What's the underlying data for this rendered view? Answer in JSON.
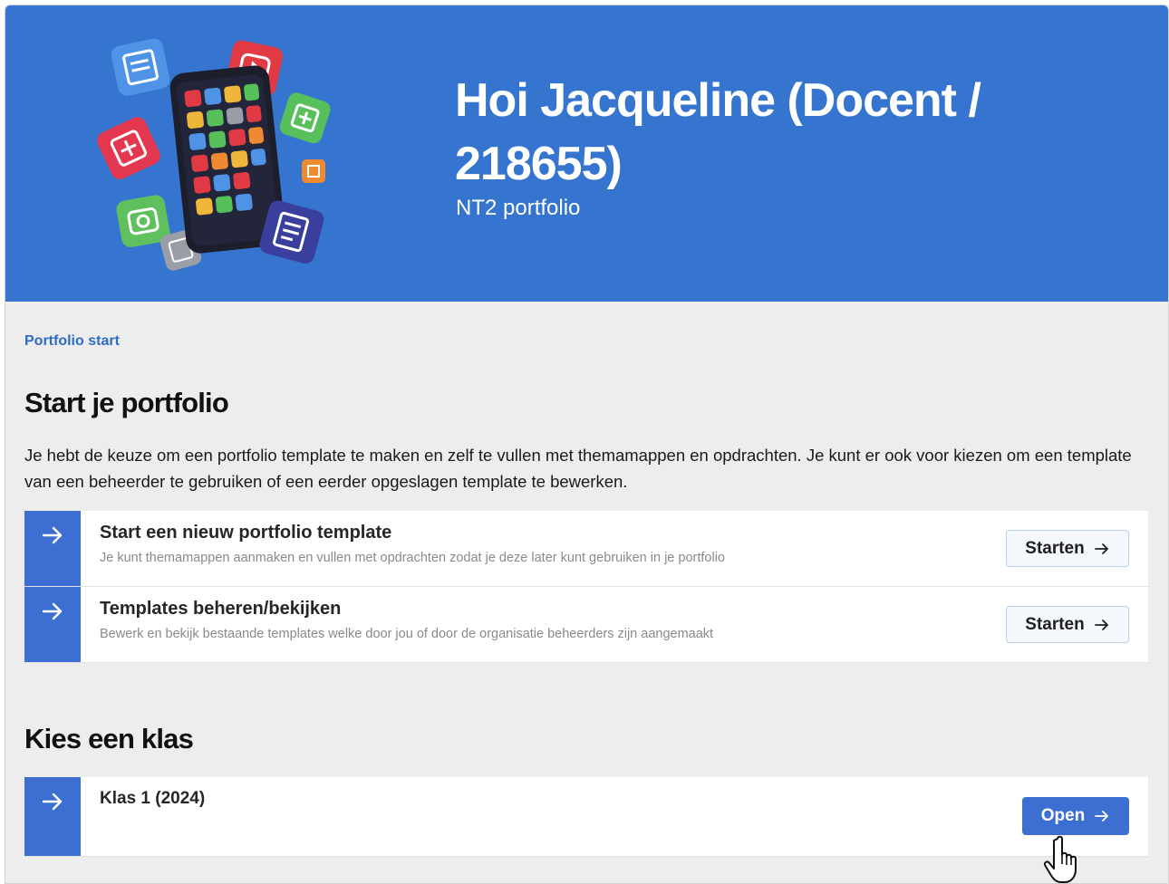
{
  "header": {
    "title": "Hoi Jacqueline (Docent / 218655)",
    "subtitle": "NT2 portfolio",
    "background_color": "#3575d0",
    "illustration": "smartphone-with-app-icons"
  },
  "breadcrumb": {
    "label": "Portfolio start"
  },
  "start_section": {
    "heading": "Start je portfolio",
    "intro": "Je hebt de keuze om een portfolio template te maken en zelf te vullen met themamappen en opdrachten. Je kunt er ook voor kiezen om een template van een beheerder te gebruiken of een eerder opgeslagen template te bewerken.",
    "cards": [
      {
        "title": "Start een nieuw portfolio template",
        "description": "Je kunt themamappen aanmaken en vullen met opdrachten zodat je deze later kunt gebruiken in je portfolio",
        "button": "Starten"
      },
      {
        "title": "Templates beheren/bekijken",
        "description": "Bewerk en bekijk bestaande templates welke door jou of door de organisatie beheerders zijn aangemaakt",
        "button": "Starten"
      }
    ]
  },
  "class_section": {
    "heading": "Kies een klas",
    "cards": [
      {
        "title": "Klas 1 (2024)",
        "button": "Open"
      }
    ]
  },
  "colors": {
    "accent": "#3c6fd1",
    "link": "#2f6cc4",
    "page_bg": "#ededee"
  },
  "icons": [
    "arrow-right-icon",
    "hand-pointer-cursor"
  ]
}
